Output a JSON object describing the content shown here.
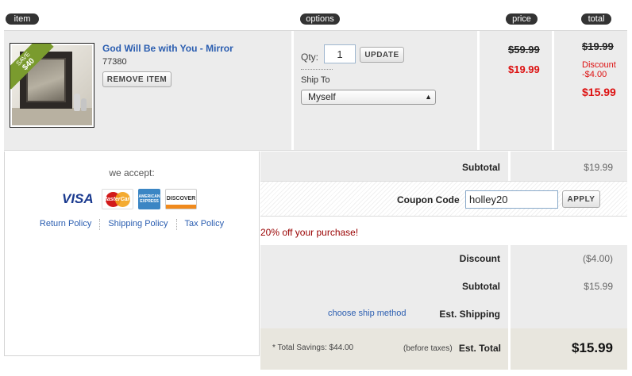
{
  "headers": {
    "item": "item",
    "options": "options",
    "price": "price",
    "total": "total"
  },
  "product": {
    "title": "God Will Be with You - Mirror",
    "sku": "77380",
    "remove_label": "REMOVE ITEM",
    "ribbon_top": "SAVE",
    "ribbon_amount": "$40"
  },
  "options": {
    "qty_label": "Qty:",
    "qty_value": "1",
    "update_label": "UPDATE",
    "ship_to_label": "Ship To",
    "ship_to_value": "Myself"
  },
  "price": {
    "original": "$59.99",
    "sale": "$19.99"
  },
  "line_total": {
    "original": "$19.99",
    "discount_label": "Discount",
    "discount_value": "-$4.00",
    "final": "$15.99"
  },
  "payment": {
    "accept_label": "we accept:",
    "cards": {
      "visa": "VISA",
      "mastercard": "MasterCard",
      "amex": "AMERICAN EXPRESS",
      "discover": "DISCOVER"
    }
  },
  "policies": [
    "Return Policy",
    "Shipping Policy",
    "Tax Policy"
  ],
  "summary": {
    "subtotal_label": "Subtotal",
    "subtotal_value": "$19.99",
    "coupon_label": "Coupon Code",
    "coupon_value": "holley20",
    "apply_label": "APPLY",
    "promo_message": "20% off your purchase!",
    "discount_label": "Discount",
    "discount_value": "($4.00)",
    "subtotal2_label": "Subtotal",
    "subtotal2_value": "$15.99",
    "ship_method_link": "choose ship method",
    "shipping_label": "Est. Shipping",
    "savings_note": "* Total Savings: $44.00",
    "before_taxes": "(before taxes)",
    "total_label": "Est. Total",
    "total_value": "$15.99"
  }
}
